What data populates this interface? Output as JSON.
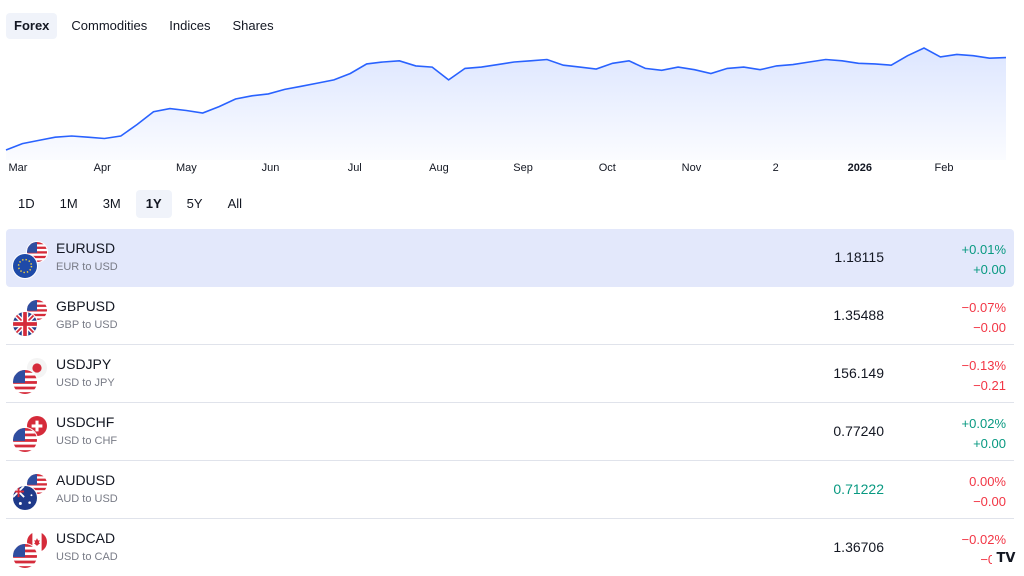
{
  "market_tabs": [
    {
      "label": "Forex",
      "active": true
    },
    {
      "label": "Commodities",
      "active": false
    },
    {
      "label": "Indices",
      "active": false
    },
    {
      "label": "Shares",
      "active": false
    }
  ],
  "chart_data": {
    "type": "area",
    "line_color": "#2962ff",
    "x_ticks": [
      "Mar",
      "Apr",
      "May",
      "Jun",
      "Jul",
      "Aug",
      "Sep",
      "Oct",
      "Nov",
      "2",
      "2026",
      "Feb"
    ],
    "bold_ticks": [
      "2026"
    ],
    "y": [
      1.03,
      1.04,
      1.045,
      1.05,
      1.052,
      1.05,
      1.048,
      1.052,
      1.07,
      1.09,
      1.095,
      1.092,
      1.088,
      1.098,
      1.11,
      1.115,
      1.118,
      1.125,
      1.13,
      1.135,
      1.14,
      1.15,
      1.165,
      1.168,
      1.17,
      1.162,
      1.16,
      1.14,
      1.158,
      1.16,
      1.164,
      1.168,
      1.17,
      1.172,
      1.163,
      1.16,
      1.157,
      1.166,
      1.17,
      1.158,
      1.155,
      1.16,
      1.156,
      1.15,
      1.158,
      1.16,
      1.156,
      1.162,
      1.164,
      1.168,
      1.172,
      1.17,
      1.166,
      1.165,
      1.163,
      1.178,
      1.19,
      1.176,
      1.18,
      1.178,
      1.174,
      1.175
    ]
  },
  "ranges": [
    {
      "label": "1D",
      "active": false
    },
    {
      "label": "1M",
      "active": false
    },
    {
      "label": "3M",
      "active": false
    },
    {
      "label": "1Y",
      "active": true
    },
    {
      "label": "5Y",
      "active": false
    },
    {
      "label": "All",
      "active": false
    }
  ],
  "rows": [
    {
      "symbol": "EURUSD",
      "desc": "EUR to USD",
      "price": "1.18115",
      "price_dir": "flat",
      "chg_pct": "+0.01%",
      "chg_abs": "+0.00",
      "dir": "up",
      "selected": true,
      "base": "eu",
      "quote": "us"
    },
    {
      "symbol": "GBPUSD",
      "desc": "GBP to USD",
      "price": "1.35488",
      "price_dir": "flat",
      "chg_pct": "−0.07%",
      "chg_abs": "−0.00",
      "dir": "down",
      "selected": false,
      "base": "gb",
      "quote": "us"
    },
    {
      "symbol": "USDJPY",
      "desc": "USD to JPY",
      "price": "156.149",
      "price_dir": "flat",
      "chg_pct": "−0.13%",
      "chg_abs": "−0.21",
      "dir": "down",
      "selected": false,
      "base": "us",
      "quote": "jp"
    },
    {
      "symbol": "USDCHF",
      "desc": "USD to CHF",
      "price": "0.77240",
      "price_dir": "flat",
      "chg_pct": "+0.02%",
      "chg_abs": "+0.00",
      "dir": "up",
      "selected": false,
      "base": "us",
      "quote": "ch"
    },
    {
      "symbol": "AUDUSD",
      "desc": "AUD to USD",
      "price": "0.71222",
      "price_dir": "up",
      "chg_pct": "0.00%",
      "chg_abs": "−0.00",
      "dir": "down",
      "selected": false,
      "base": "au",
      "quote": "us"
    },
    {
      "symbol": "USDCAD",
      "desc": "USD to CAD",
      "price": "1.36706",
      "price_dir": "flat",
      "chg_pct": "−0.02%",
      "chg_abs": "−0.0",
      "dir": "down",
      "selected": false,
      "base": "us",
      "quote": "ca"
    }
  ],
  "logo": "TV",
  "colors": {
    "up": "#089981",
    "down": "#f23645",
    "selected_row": "#e3e8fb",
    "accent": "#2962ff"
  }
}
